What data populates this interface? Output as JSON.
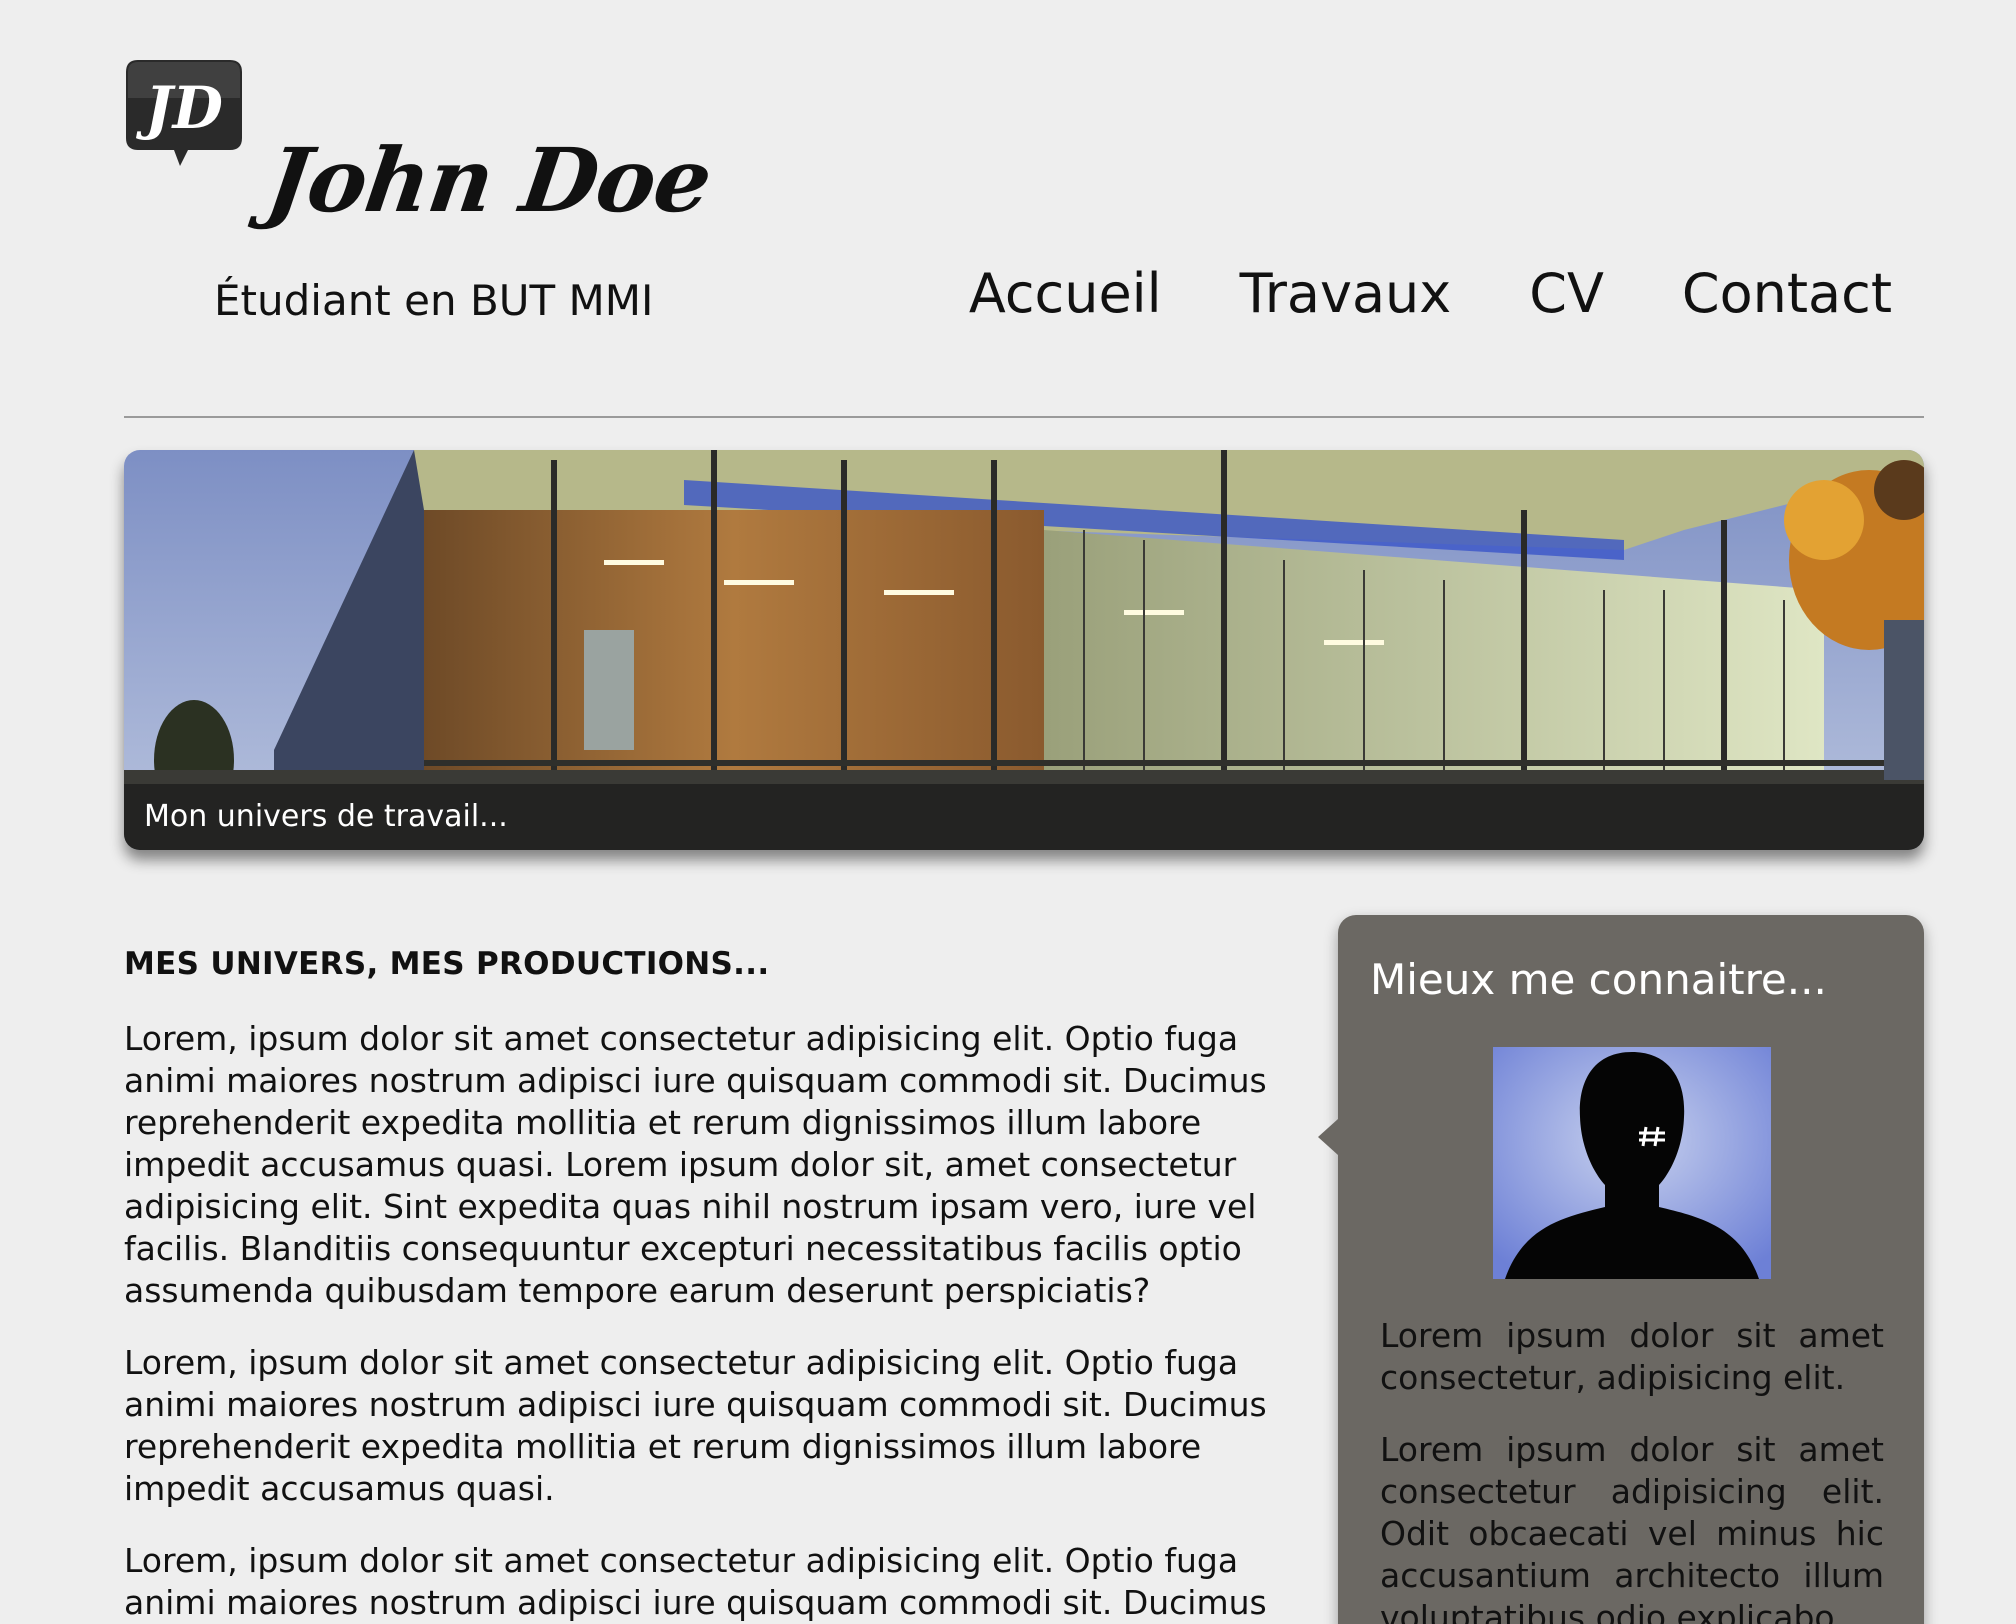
{
  "header": {
    "name": "John Doe",
    "subtitle": "Étudiant en BUT MMI",
    "logo_icon": "jd-logo-icon",
    "nav": [
      "Accueil",
      "Travaux",
      "CV",
      "Contact"
    ]
  },
  "banner": {
    "caption": "Mon univers de travail..."
  },
  "main": {
    "title": "MES UNIVERS, MES PRODUCTIONS...",
    "paragraphs": [
      "Lorem, ipsum dolor sit amet consectetur adipisicing elit. Optio fuga animi maiores nostrum adipisci iure quisquam commodi sit. Ducimus reprehenderit expedita mollitia et rerum dignissimos illum labore impedit accusamus quasi. Lorem ipsum dolor sit, amet consectetur adipisicing elit. Sint expedita quas nihil nostrum ipsam vero, iure vel facilis. Blanditiis consequuntur excepturi necessitatibus facilis optio assumenda quibusdam tempore earum deserunt perspiciatis?",
      "Lorem, ipsum dolor sit amet consectetur adipisicing elit. Optio fuga animi maiores nostrum adipisci iure quisquam commodi sit. Ducimus reprehenderit expedita mollitia et rerum dignissimos illum labore impedit accusamus quasi.",
      "Lorem, ipsum dolor sit amet consectetur adipisicing elit. Optio fuga animi maiores nostrum adipisci iure quisquam commodi sit. Ducimus"
    ]
  },
  "sidebar": {
    "title": "Mieux me connaitre...",
    "avatar_icon": "person-silhouette-icon",
    "paragraphs": [
      "Lorem ipsum dolor sit amet consectetur, adipisicing elit.",
      "Lorem ipsum dolor sit amet consectetur adipisicing elit. Odit obcaecati vel minus hic accusantium architecto illum voluptatibus odio explicabo"
    ]
  },
  "colors": {
    "background": "#eeeeee",
    "sidebar": "#6b6863",
    "text": "#111111"
  }
}
